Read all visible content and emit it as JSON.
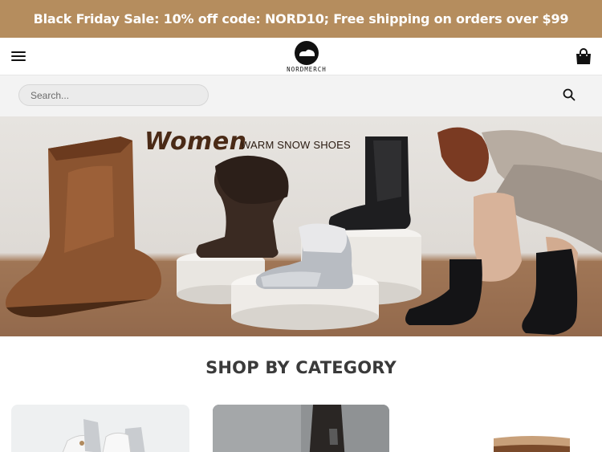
{
  "promo": {
    "text": "Black Friday Sale: 10% off code: NORD10; Free shipping on orders over $99",
    "color": "#b58d5e"
  },
  "header": {
    "menu_icon": "hamburger-menu-icon",
    "logo_text": "NORDMERCH",
    "cart_icon": "shopping-bag-icon"
  },
  "search": {
    "placeholder": "Search...",
    "value": "",
    "icon": "search-icon"
  },
  "hero": {
    "title": "Women",
    "subtitle": "WARM SNOW SHOES"
  },
  "categories": {
    "title": "SHOP BY CATEGORY"
  },
  "colors": {
    "accent": "#b58d5e",
    "heading": "#3a3a3a",
    "hero_title": "#4a2a16"
  }
}
